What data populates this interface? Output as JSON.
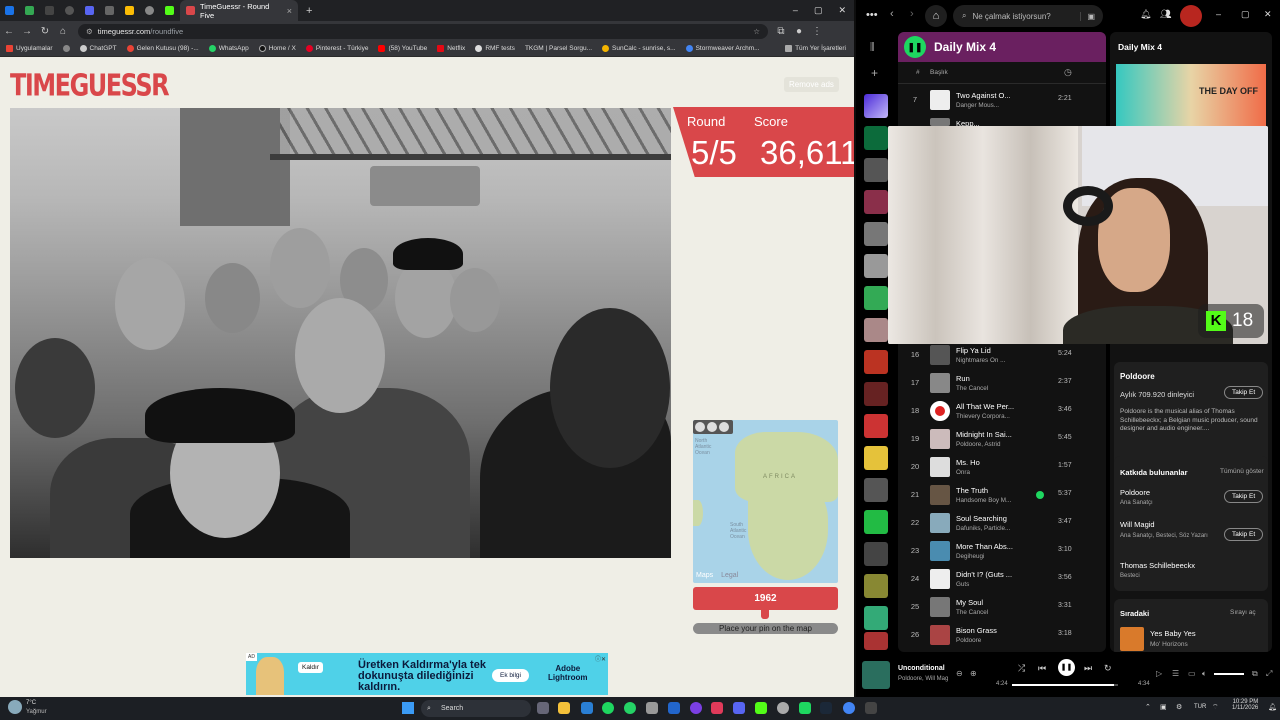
{
  "browser": {
    "tab_title": "TimeGuessr - Round Five",
    "url_host": "timeguessr.com",
    "url_path": "/roundfive",
    "bookmarks": [
      "Uygulamalar",
      "ChatGPT",
      "Gelen Kutusu (98) -...",
      "WhatsApp",
      "Home / X",
      "Pinterest - Türkiye",
      "(58) YouTube",
      "Netflix",
      "RMF tests",
      "TKGM | Parsel Sorgu...",
      "SunCalc - sunrise, s...",
      "Stormweaver Archm..."
    ],
    "all_bookmarks": "Tüm Yer İşaretleri"
  },
  "game": {
    "logo": "TIMEGUESSR",
    "remove_ads": "Remove ads",
    "round_label": "Round",
    "score_label": "Score",
    "round_value": "5/5",
    "score_value": "36,611",
    "map_label_africa": "AFRICA",
    "map_label_north": "North Atlantic Ocean",
    "map_label_south": "South Atlantic Ocean",
    "maps_brand": "Maps",
    "maps_legal": "Legal",
    "year": "1962",
    "place_pin": "Place your pin on the map"
  },
  "ad": {
    "tag": "AD",
    "kaldir": "Kaldır",
    "headline": "Üretken Kaldırma'yla tek dokunuşta dilediğinizi kaldırın.",
    "cta": "Ek bilgi",
    "brand_line1": "Adobe",
    "brand_line2": "Lightroom"
  },
  "spotify": {
    "search_placeholder": "Ne çalmak istiyorsun?",
    "playlist_title": "Daily Mix 4",
    "col_title": "Başlık",
    "tracks_top": [
      {
        "num": "7",
        "title": "Two Against O...",
        "artist": "Danger Mous...",
        "dur": "2:21"
      },
      {
        "num": "",
        "title": "Kepp...",
        "artist": "",
        "dur": ""
      }
    ],
    "tracks": [
      {
        "num": "16",
        "title": "Flip Ya Lid",
        "artist": "Nightmares On ...",
        "dur": "5:24"
      },
      {
        "num": "17",
        "title": "Run",
        "artist": "The Cancel",
        "dur": "2:37"
      },
      {
        "num": "18",
        "title": "All That We Per...",
        "artist": "Thievery Corpora...",
        "dur": "3:46"
      },
      {
        "num": "19",
        "title": "Midnight In Sai...",
        "artist": "Poldoore, Astrid",
        "dur": "5:45"
      },
      {
        "num": "20",
        "title": "Ms. Ho",
        "artist": "Onra",
        "dur": "1:57"
      },
      {
        "num": "21",
        "title": "The Truth",
        "artist": "Handsome Boy M...",
        "dur": "5:37"
      },
      {
        "num": "22",
        "title": "Soul Searching",
        "artist": "Dafuniks, Particle...",
        "dur": "3:47"
      },
      {
        "num": "23",
        "title": "More Than Abs...",
        "artist": "Degiheugi",
        "dur": "3:10"
      },
      {
        "num": "24",
        "title": "Didn't I? (Guts ...",
        "artist": "Guts",
        "dur": "3:56"
      },
      {
        "num": "25",
        "title": "My Soul",
        "artist": "The Cancel",
        "dur": "3:31"
      },
      {
        "num": "26",
        "title": "Bison Grass",
        "artist": "Poldoore",
        "dur": "3:18"
      }
    ],
    "right_title": "Daily Mix 4",
    "cover_text": "THE DAY OFF",
    "kick_count": "18",
    "about_artist": "Poldoore",
    "monthly_listeners": "Aylık 709.920 dinleyici",
    "follow": "Takip Et",
    "bio": "Poldoore is the musical alias of Thomas Schillebeeckx; a Belgian music producer, sound designer and audio engineer....",
    "credits_title": "Katkıda bulunanlar",
    "show_all": "Tümünü göster",
    "credits": [
      {
        "name": "Poldoore",
        "role": "Ana Sanatçı",
        "follow": true
      },
      {
        "name": "Will Magid",
        "role": "Ana Sanatçı, Besteci, Söz Yazarı",
        "follow": true
      },
      {
        "name": "Thomas Schillebeeckx",
        "role": "Besteci",
        "follow": false
      }
    ],
    "queue_title": "Sıradaki",
    "queue_open": "Sırayı aç",
    "queue_track": "Yes Baby Yes",
    "queue_artist": "Mo' Horizons",
    "now_title": "Unconditional",
    "now_artist": "Poldoore, Will Mag",
    "time_elapsed": "4:24",
    "time_total": "4:34",
    "progress": 0.96
  },
  "taskbar": {
    "temp": "7°C",
    "weather": "Yağmur",
    "search": "Search",
    "lang": "TUR",
    "time": "10:29 PM",
    "date": "1/11/2026"
  },
  "colors": {
    "accent": "#d9474a",
    "spotify_green": "#1ed760",
    "kick_green": "#53fc18"
  }
}
